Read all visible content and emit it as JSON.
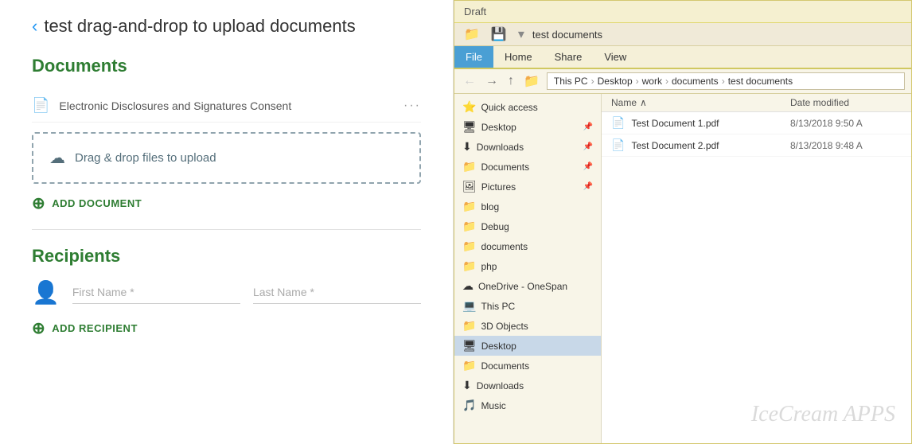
{
  "left": {
    "back_label": "test drag-and-drop to upload documents",
    "documents_heading": "Documents",
    "document_item": {
      "name": "Electronic Disclosures and Signatures Consent",
      "menu": "···"
    },
    "drop_zone_label": "Drag & drop files to upload",
    "add_document_label": "ADD DOCUMENT",
    "recipients_heading": "Recipients",
    "recipient": {
      "first_name_placeholder": "First Name *",
      "last_name_placeholder": "Last Name *"
    },
    "add_recipient_label": "ADD RECIPIENT"
  },
  "right": {
    "draft_label": "Draft",
    "titlebar": {
      "folder_name": "test documents"
    },
    "ribbon_tabs": [
      "File",
      "Home",
      "Share",
      "View"
    ],
    "active_tab": "File",
    "breadcrumb": [
      "This PC",
      "Desktop",
      "work",
      "documents",
      "test documents"
    ],
    "column_headers": {
      "name": "Name",
      "date_modified": "Date modified"
    },
    "sidebar_items": [
      {
        "label": "Quick access",
        "icon": "⭐",
        "type": "section",
        "pin": false
      },
      {
        "label": "Desktop",
        "icon": "🖥",
        "pin": true
      },
      {
        "label": "Downloads",
        "icon": "⬇",
        "pin": true
      },
      {
        "label": "Documents",
        "icon": "📁",
        "pin": true
      },
      {
        "label": "Pictures",
        "icon": "🖼",
        "pin": true
      },
      {
        "label": "blog",
        "icon": "📁",
        "pin": false
      },
      {
        "label": "Debug",
        "icon": "📁",
        "pin": false
      },
      {
        "label": "documents",
        "icon": "📁",
        "pin": false
      },
      {
        "label": "php",
        "icon": "📁",
        "pin": false
      },
      {
        "label": "OneDrive - OneSpan",
        "icon": "☁",
        "pin": false
      },
      {
        "label": "This PC",
        "icon": "💻",
        "pin": false
      },
      {
        "label": "3D Objects",
        "icon": "📁",
        "pin": false
      },
      {
        "label": "Desktop",
        "icon": "🖥",
        "selected": true,
        "pin": false
      },
      {
        "label": "Documents",
        "icon": "📁",
        "pin": false
      },
      {
        "label": "Downloads",
        "icon": "⬇",
        "pin": false
      },
      {
        "label": "Music",
        "icon": "🎵",
        "pin": false
      }
    ],
    "files": [
      {
        "name": "Test Document 1.pdf",
        "date": "8/13/2018 9:50 A"
      },
      {
        "name": "Test Document 2.pdf",
        "date": "8/13/2018 9:48 A"
      }
    ],
    "watermark": "IceCream APPS"
  }
}
